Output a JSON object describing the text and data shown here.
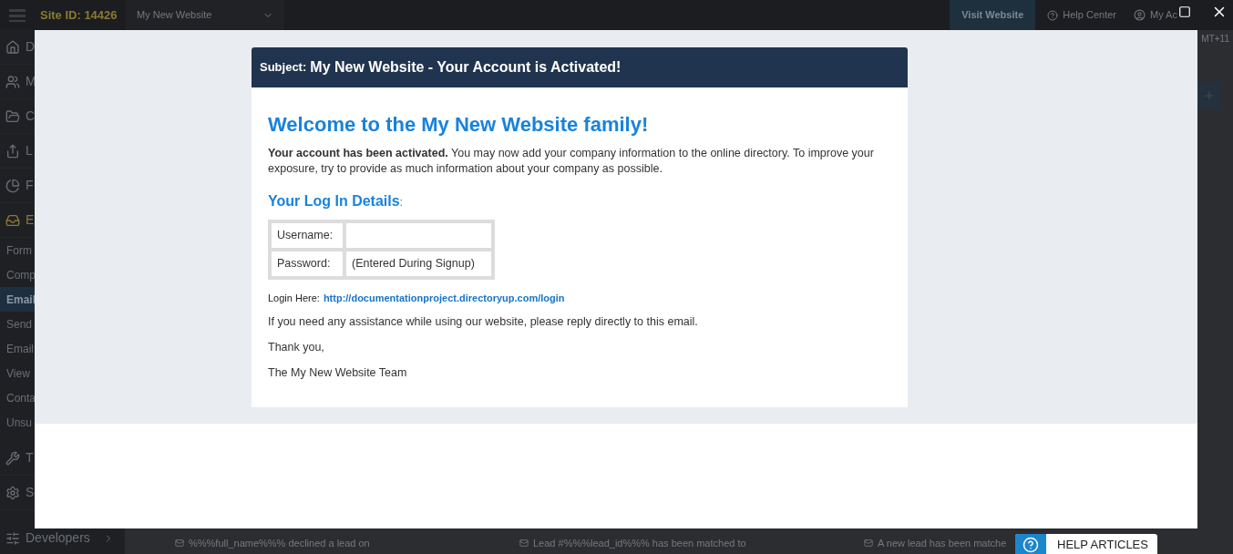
{
  "topbar": {
    "site_id": "Site ID: 14426",
    "site_select": "My New Website",
    "buttons": [
      {
        "kind": "primary",
        "label": "Visit Website"
      },
      {
        "kind": "help",
        "label": "Help Center"
      },
      {
        "kind": "account",
        "label": "My Ac"
      }
    ]
  },
  "sidebar": {
    "items": [
      {
        "kind": "main",
        "label": "D",
        "selected": false
      },
      {
        "kind": "main",
        "label": "M",
        "selected": false
      },
      {
        "kind": "main",
        "label": "C",
        "selected": false
      },
      {
        "kind": "main",
        "label": "L",
        "selected": false
      },
      {
        "kind": "main",
        "label": "F",
        "selected": false
      },
      {
        "kind": "main",
        "label": "E",
        "selected": true
      },
      {
        "kind": "sub",
        "label": "Form",
        "selected": false
      },
      {
        "kind": "sub",
        "label": "Comp",
        "selected": false
      },
      {
        "kind": "sub",
        "label": "Email",
        "selected": true
      },
      {
        "kind": "sub",
        "label": "Send",
        "selected": false
      },
      {
        "kind": "sub",
        "label": "Email",
        "selected": false
      },
      {
        "kind": "sub",
        "label": "View",
        "selected": false
      },
      {
        "kind": "sub",
        "label": "Conta",
        "selected": false
      },
      {
        "kind": "sub",
        "label": "Unsu",
        "selected": false
      },
      {
        "kind": "main",
        "label": "T",
        "selected": false
      },
      {
        "kind": "main",
        "label": "S",
        "selected": false
      },
      {
        "kind": "last",
        "label": "Developers",
        "selected": false
      }
    ]
  },
  "timezone": "MT+11",
  "feed": [
    "%%%full_name%%% declined a lead on",
    "Lead #%%%lead_id%%% has been matched to",
    "A new lead has been matche"
  ],
  "help_button": "HELP ARTICLES",
  "email": {
    "subject_label": "Subject:",
    "subject": "My New Website - Your Account is Activated!",
    "heading": "Welcome to the My New Website family!",
    "intro": "**Your account has been activated.** You may now add your company information to the online directory. To improve your exposure, try to provide as much information about your company as possible.",
    "details_heading": "Your Log In Details",
    "details_colon": ":",
    "fields": [
      {
        "label": "Username:"
      },
      {
        "label": "Password:",
        "value": "(Entered During Signup)"
      }
    ],
    "login_label": "Login Here:",
    "login_link": "http://documentationproject.directoryup.com/login",
    "paragraphs": [
      "If you need any assistance while using our website, please reply directly to this email.",
      "Thank you,",
      "The My New Website Team"
    ]
  }
}
